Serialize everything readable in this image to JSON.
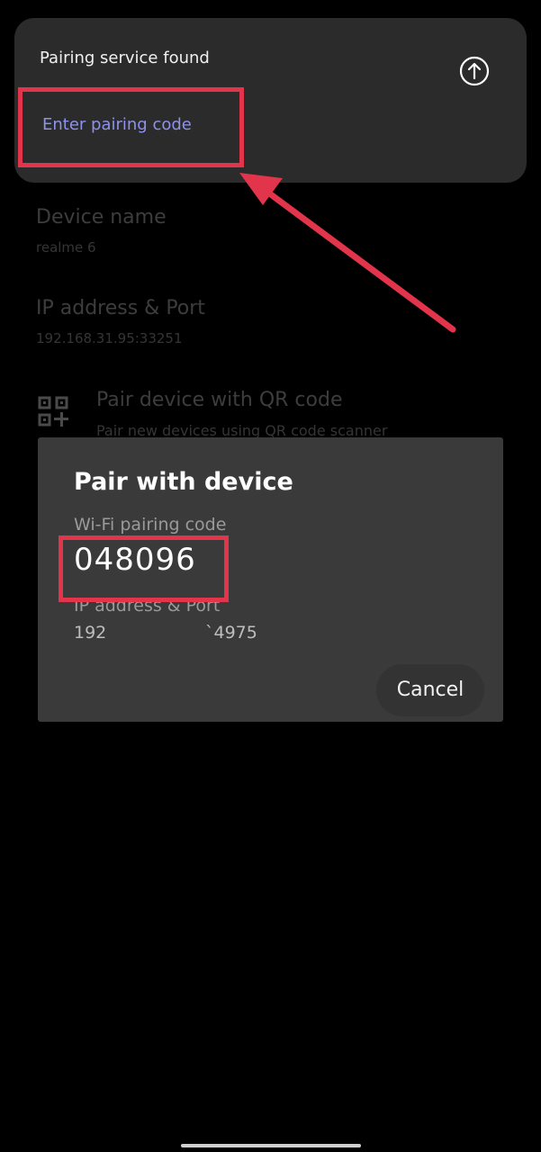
{
  "notification": {
    "title": "Pairing service found",
    "action_label": "Enter pairing code",
    "expand_icon": "arrow-up-circle-icon"
  },
  "background_list": {
    "device_name_title": "Device name",
    "device_name_value": "realme 6",
    "ip_title": "IP address & Port",
    "ip_value": "192.168.31.95:33251",
    "qr_title": "Pair device with QR code",
    "qr_subtitle": "Pair new devices using QR code scanner",
    "qr_icon": "qr-code-add-icon"
  },
  "dialog": {
    "title": "Pair with device",
    "code_label": "Wi-Fi pairing code",
    "code": "048096",
    "ip_label": "IP address & Port",
    "ip_value_start": "192",
    "ip_value_end": "`4975",
    "cancel_label": "Cancel"
  },
  "colors": {
    "accent_link": "#8e92ea",
    "annotation_red": "#e2344a",
    "dialog_bg": "#3a3a3a",
    "card_bg": "#2b2b2b"
  }
}
